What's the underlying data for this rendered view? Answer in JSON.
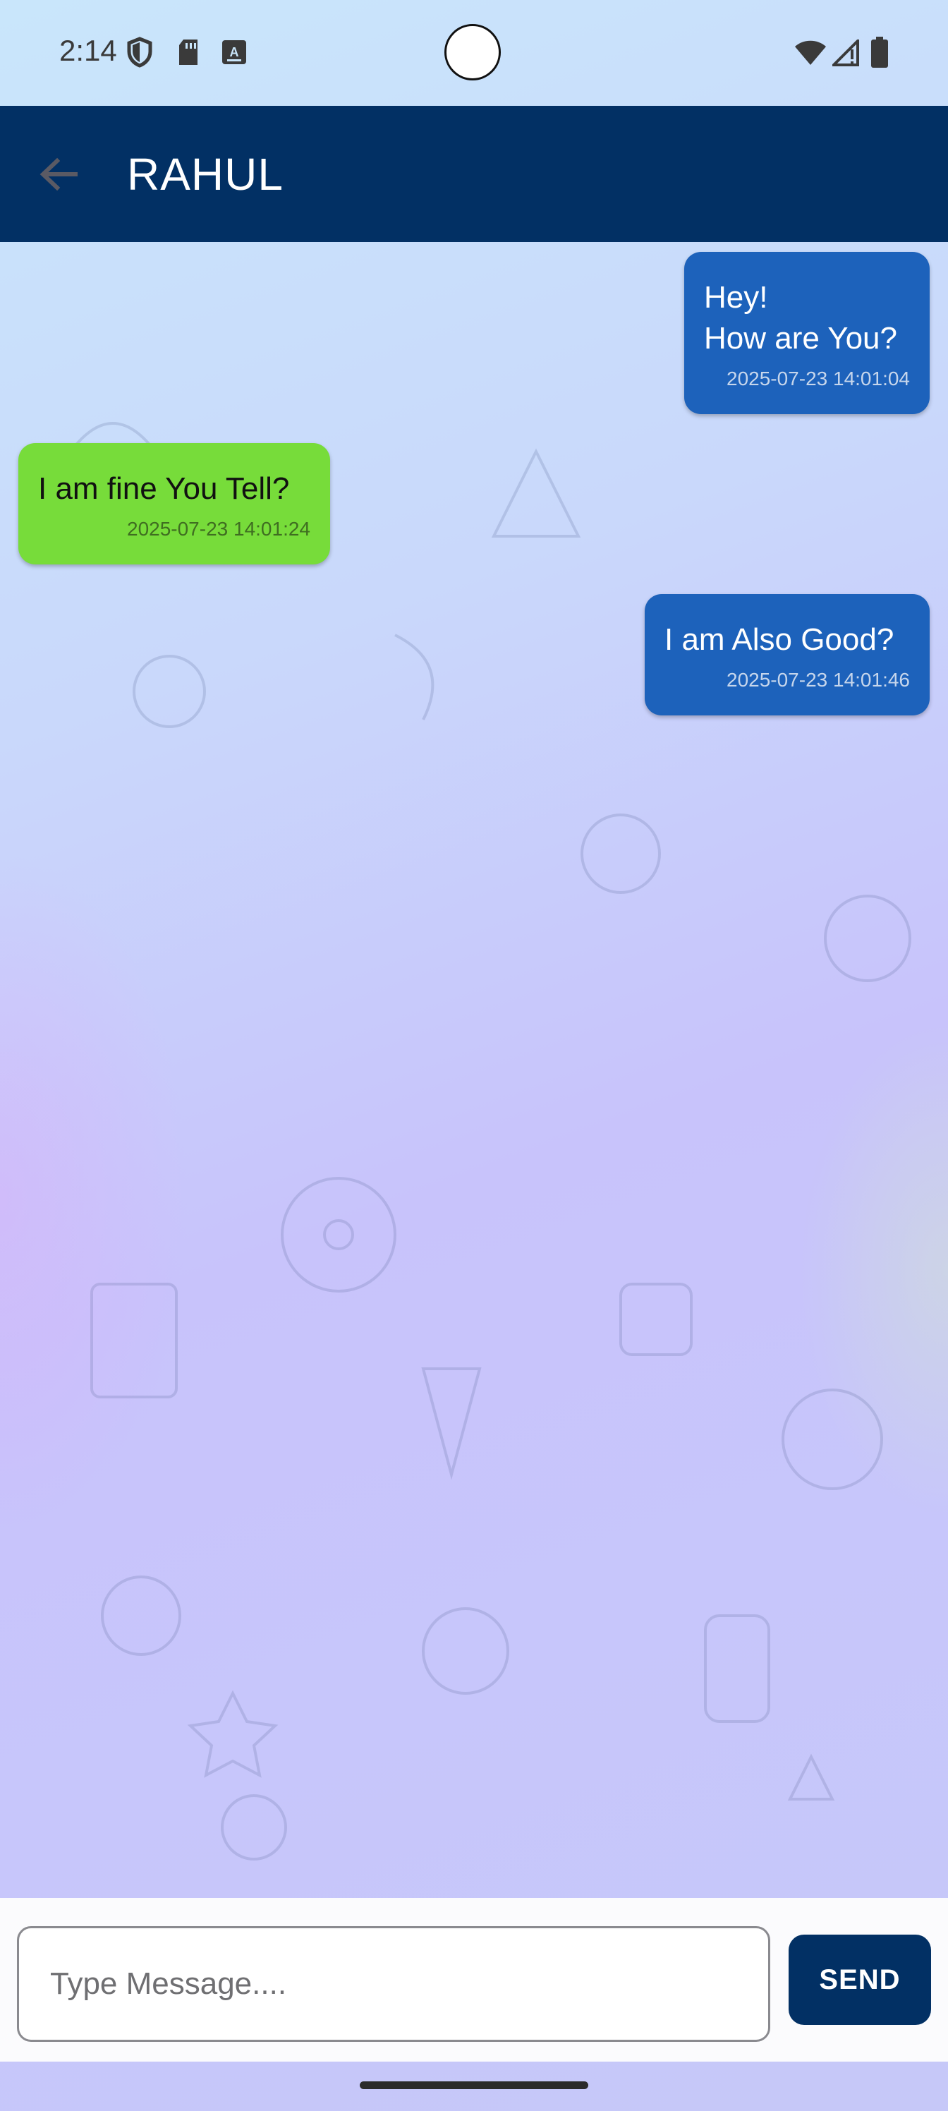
{
  "status_bar": {
    "time": "2:14",
    "icons": [
      "shield-icon",
      "sd-card-icon",
      "keyboard-a-icon",
      "wifi-icon",
      "signal-icon",
      "battery-icon"
    ]
  },
  "app_bar": {
    "back_icon": "arrow-back-icon",
    "title": "RAHUL",
    "background_color": "#023064"
  },
  "messages": [
    {
      "direction": "outgoing",
      "text": "Hey!\nHow are You?",
      "timestamp": "2025-07-23 14:01:04",
      "color": "#1d62bb"
    },
    {
      "direction": "incoming",
      "text": "I am fine You Tell?",
      "timestamp": "2025-07-23 14:01:24",
      "color": "#77dc3a"
    },
    {
      "direction": "outgoing",
      "text": "I am Also Good?",
      "timestamp": "2025-07-23 14:01:46",
      "color": "#1d62bb"
    }
  ],
  "composer": {
    "placeholder": "Type Message....",
    "value": "",
    "send_label": "SEND"
  }
}
